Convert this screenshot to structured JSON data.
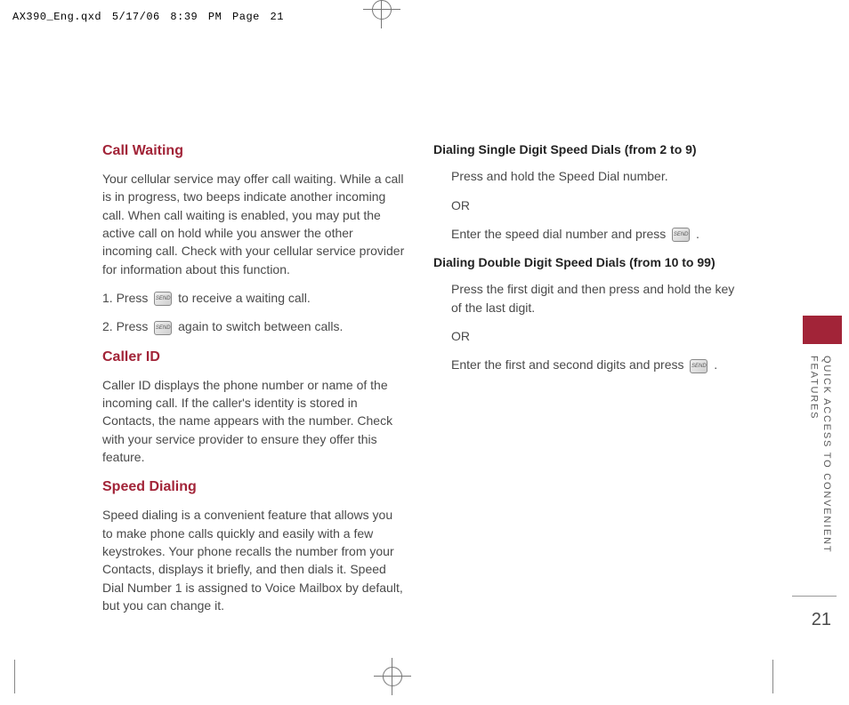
{
  "header": {
    "slug": "AX390_Eng.qxd  5/17/06  8:39 PM  Page 21"
  },
  "left": {
    "h1": "Call Waiting",
    "p1": "Your cellular service may offer call waiting. While a call is in progress, two beeps indicate another incoming call. When call waiting is enabled, you may put the active call on hold while you answer the other incoming call. Check with your cellular service provider for information about this function.",
    "l1a": "1. Press ",
    "l1b": " to receive a waiting call.",
    "l2a": "2. Press ",
    "l2b": " again to switch between calls.",
    "h2": "Caller ID",
    "p2": "Caller ID displays the phone number or name of the incoming call. If the caller's identity is stored in Contacts, the name appears with the number. Check with your service provider to ensure they offer this feature.",
    "h3": "Speed Dialing",
    "p3": "Speed dialing is a convenient feature that allows you to make phone calls quickly and easily with a few keystrokes. Your phone recalls the number from your Contacts, displays it briefly, and then dials it. Speed Dial Number 1 is assigned to Voice Mailbox by default, but you can change it."
  },
  "right": {
    "h1": "Dialing Single Digit Speed Dials (from 2 to 9)",
    "r1": "Press and hold the Speed Dial number.",
    "or": "OR",
    "r2a": "Enter the speed dial number and press ",
    "r2b": ".",
    "h2": "Dialing Double Digit Speed Dials (from 10 to 99)",
    "r3": "Press the first digit and then press and hold the key of the last digit.",
    "r4a": "Enter the first and second digits and press ",
    "r4b": "."
  },
  "meta": {
    "section_line1": "QUICK ACCESS TO CONVENIENT",
    "section_line2": "FEATURES",
    "page_num": "21",
    "send_label": "SEND"
  }
}
